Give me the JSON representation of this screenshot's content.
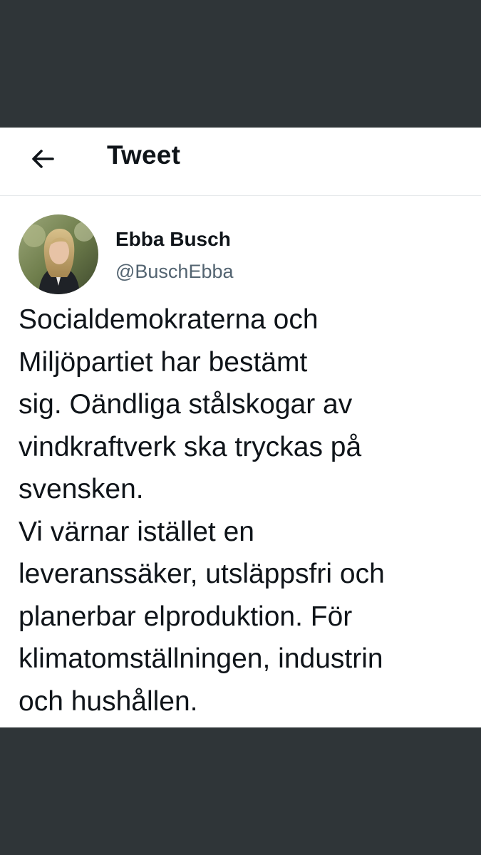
{
  "header": {
    "title": "Tweet",
    "back_icon": "arrow-left-icon"
  },
  "tweet": {
    "author_name": "Ebba Busch",
    "author_handle": "@BuschEbba",
    "avatar_icon": "avatar",
    "text": "Socialdemokraterna och\nMiljöpartiet har bestämt\nsig. Oändliga stålskogar av\nvindkraftverk ska tryckas på\nsvensken.\nVi värnar istället en\nleveranssäker, utsläppsfri och\nplanerbar elproduktion. För\nklimatomställningen, industrin\noch hushållen."
  },
  "colors": {
    "background": "#2f3538",
    "card": "#ffffff",
    "text_primary": "#0f1419",
    "text_secondary": "#536471",
    "divider": "#e6e9eb"
  }
}
